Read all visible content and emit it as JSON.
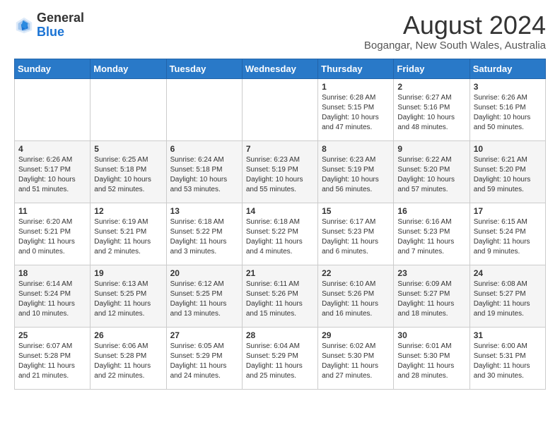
{
  "header": {
    "logo_general": "General",
    "logo_blue": "Blue",
    "month_title": "August 2024",
    "location": "Bogangar, New South Wales, Australia"
  },
  "calendar": {
    "days_of_week": [
      "Sunday",
      "Monday",
      "Tuesday",
      "Wednesday",
      "Thursday",
      "Friday",
      "Saturday"
    ],
    "weeks": [
      [
        {
          "day": "",
          "info": ""
        },
        {
          "day": "",
          "info": ""
        },
        {
          "day": "",
          "info": ""
        },
        {
          "day": "",
          "info": ""
        },
        {
          "day": "1",
          "info": "Sunrise: 6:28 AM\nSunset: 5:15 PM\nDaylight: 10 hours\nand 47 minutes."
        },
        {
          "day": "2",
          "info": "Sunrise: 6:27 AM\nSunset: 5:16 PM\nDaylight: 10 hours\nand 48 minutes."
        },
        {
          "day": "3",
          "info": "Sunrise: 6:26 AM\nSunset: 5:16 PM\nDaylight: 10 hours\nand 50 minutes."
        }
      ],
      [
        {
          "day": "4",
          "info": "Sunrise: 6:26 AM\nSunset: 5:17 PM\nDaylight: 10 hours\nand 51 minutes."
        },
        {
          "day": "5",
          "info": "Sunrise: 6:25 AM\nSunset: 5:18 PM\nDaylight: 10 hours\nand 52 minutes."
        },
        {
          "day": "6",
          "info": "Sunrise: 6:24 AM\nSunset: 5:18 PM\nDaylight: 10 hours\nand 53 minutes."
        },
        {
          "day": "7",
          "info": "Sunrise: 6:23 AM\nSunset: 5:19 PM\nDaylight: 10 hours\nand 55 minutes."
        },
        {
          "day": "8",
          "info": "Sunrise: 6:23 AM\nSunset: 5:19 PM\nDaylight: 10 hours\nand 56 minutes."
        },
        {
          "day": "9",
          "info": "Sunrise: 6:22 AM\nSunset: 5:20 PM\nDaylight: 10 hours\nand 57 minutes."
        },
        {
          "day": "10",
          "info": "Sunrise: 6:21 AM\nSunset: 5:20 PM\nDaylight: 10 hours\nand 59 minutes."
        }
      ],
      [
        {
          "day": "11",
          "info": "Sunrise: 6:20 AM\nSunset: 5:21 PM\nDaylight: 11 hours\nand 0 minutes."
        },
        {
          "day": "12",
          "info": "Sunrise: 6:19 AM\nSunset: 5:21 PM\nDaylight: 11 hours\nand 2 minutes."
        },
        {
          "day": "13",
          "info": "Sunrise: 6:18 AM\nSunset: 5:22 PM\nDaylight: 11 hours\nand 3 minutes."
        },
        {
          "day": "14",
          "info": "Sunrise: 6:18 AM\nSunset: 5:22 PM\nDaylight: 11 hours\nand 4 minutes."
        },
        {
          "day": "15",
          "info": "Sunrise: 6:17 AM\nSunset: 5:23 PM\nDaylight: 11 hours\nand 6 minutes."
        },
        {
          "day": "16",
          "info": "Sunrise: 6:16 AM\nSunset: 5:23 PM\nDaylight: 11 hours\nand 7 minutes."
        },
        {
          "day": "17",
          "info": "Sunrise: 6:15 AM\nSunset: 5:24 PM\nDaylight: 11 hours\nand 9 minutes."
        }
      ],
      [
        {
          "day": "18",
          "info": "Sunrise: 6:14 AM\nSunset: 5:24 PM\nDaylight: 11 hours\nand 10 minutes."
        },
        {
          "day": "19",
          "info": "Sunrise: 6:13 AM\nSunset: 5:25 PM\nDaylight: 11 hours\nand 12 minutes."
        },
        {
          "day": "20",
          "info": "Sunrise: 6:12 AM\nSunset: 5:25 PM\nDaylight: 11 hours\nand 13 minutes."
        },
        {
          "day": "21",
          "info": "Sunrise: 6:11 AM\nSunset: 5:26 PM\nDaylight: 11 hours\nand 15 minutes."
        },
        {
          "day": "22",
          "info": "Sunrise: 6:10 AM\nSunset: 5:26 PM\nDaylight: 11 hours\nand 16 minutes."
        },
        {
          "day": "23",
          "info": "Sunrise: 6:09 AM\nSunset: 5:27 PM\nDaylight: 11 hours\nand 18 minutes."
        },
        {
          "day": "24",
          "info": "Sunrise: 6:08 AM\nSunset: 5:27 PM\nDaylight: 11 hours\nand 19 minutes."
        }
      ],
      [
        {
          "day": "25",
          "info": "Sunrise: 6:07 AM\nSunset: 5:28 PM\nDaylight: 11 hours\nand 21 minutes."
        },
        {
          "day": "26",
          "info": "Sunrise: 6:06 AM\nSunset: 5:28 PM\nDaylight: 11 hours\nand 22 minutes."
        },
        {
          "day": "27",
          "info": "Sunrise: 6:05 AM\nSunset: 5:29 PM\nDaylight: 11 hours\nand 24 minutes."
        },
        {
          "day": "28",
          "info": "Sunrise: 6:04 AM\nSunset: 5:29 PM\nDaylight: 11 hours\nand 25 minutes."
        },
        {
          "day": "29",
          "info": "Sunrise: 6:02 AM\nSunset: 5:30 PM\nDaylight: 11 hours\nand 27 minutes."
        },
        {
          "day": "30",
          "info": "Sunrise: 6:01 AM\nSunset: 5:30 PM\nDaylight: 11 hours\nand 28 minutes."
        },
        {
          "day": "31",
          "info": "Sunrise: 6:00 AM\nSunset: 5:31 PM\nDaylight: 11 hours\nand 30 minutes."
        }
      ]
    ]
  }
}
